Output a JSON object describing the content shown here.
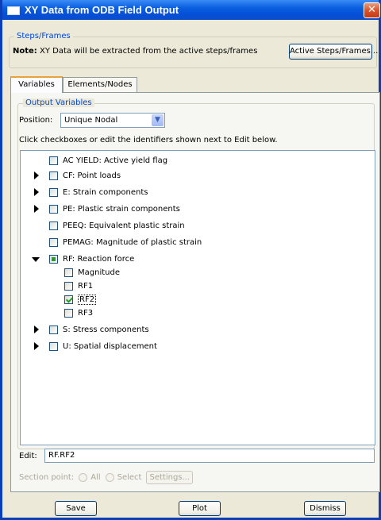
{
  "window": {
    "title": "XY Data from ODB Field Output",
    "close_glyph": "✕"
  },
  "steps_frames": {
    "group_title": "Steps/Frames",
    "note_label": "Note:",
    "note_text": "XY Data will be extracted from the active steps/frames",
    "button_label": "Active Steps/Frames..."
  },
  "tabs": [
    {
      "label": "Variables",
      "active": true
    },
    {
      "label": "Elements/Nodes",
      "active": false
    }
  ],
  "output_variables": {
    "group_title": "Output Variables",
    "position_label": "Position:",
    "position_value": "Unique Nodal",
    "instructions": "Click checkboxes or edit the identifiers shown next to Edit below."
  },
  "variables": [
    {
      "label": "AC YIELD: Active yield flag"
    },
    {
      "label": "CF: Point loads"
    },
    {
      "label": "E: Strain components"
    },
    {
      "label": "PE: Plastic strain components"
    },
    {
      "label": "PEEQ: Equivalent plastic strain"
    },
    {
      "label": "PEMAG: Magnitude of plastic strain"
    },
    {
      "label": "RF: Reaction force"
    },
    {
      "label": "Magnitude"
    },
    {
      "label": "RF1"
    },
    {
      "label": "RF2"
    },
    {
      "label": "RF3"
    },
    {
      "label": "S: Stress components"
    },
    {
      "label": "U: Spatial displacement"
    }
  ],
  "edit": {
    "label": "Edit:",
    "value": "RF.RF2"
  },
  "section_point": {
    "label": "Section point:",
    "option_all": "All",
    "option_select": "Select",
    "settings_label": "Settings..."
  },
  "buttons": {
    "save": "Save",
    "plot": "Plot",
    "dismiss": "Dismiss"
  },
  "colors": {
    "titlebar": "#0550d8",
    "group_title": "#0046d5",
    "check_green": "#21a121",
    "active_tab_accent": "#e6a33c"
  }
}
